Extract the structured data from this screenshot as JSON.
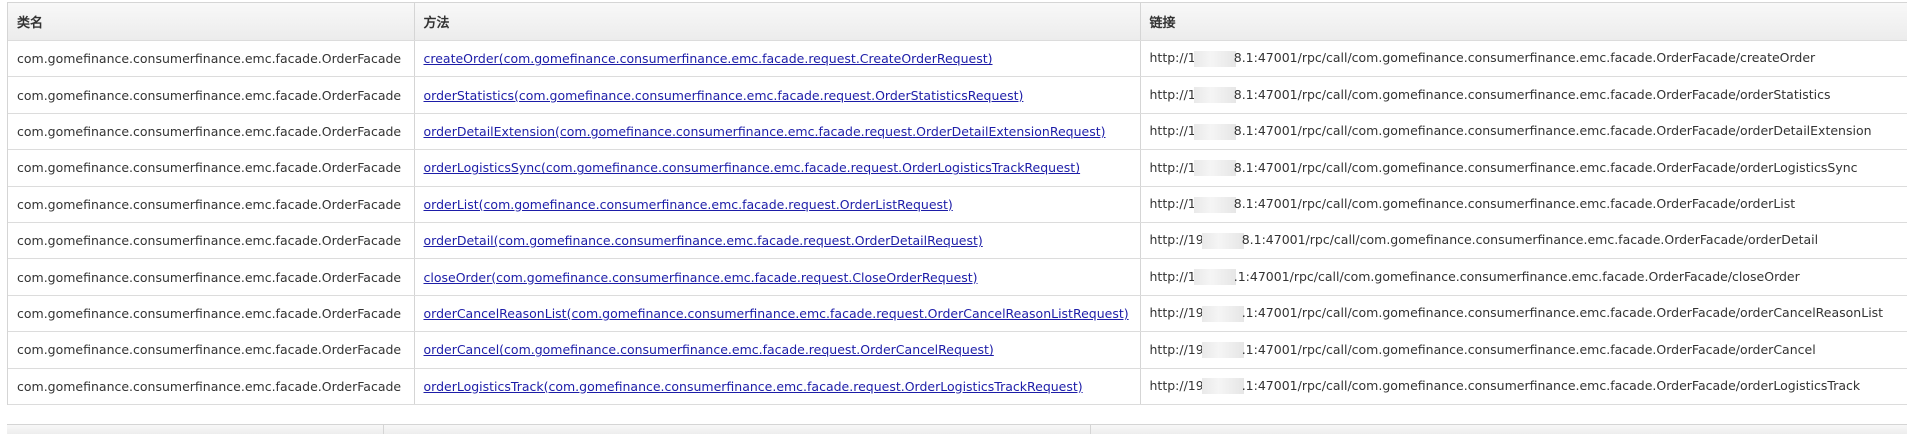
{
  "headers": {
    "class_name": "类名",
    "method": "方法",
    "link": "链接"
  },
  "rows": [
    {
      "class_name": "com.gomefinance.consumerfinance.emc.facade.OrderFacade",
      "method": "createOrder(com.gomefinance.consumerfinance.emc.facade.request.CreateOrderRequest)",
      "link_prefix": "http://1",
      "link_suffix": "8.1:47001/rpc/call/com.gomefinance.consumerfinance.emc.facade.OrderFacade/createOrder"
    },
    {
      "class_name": "com.gomefinance.consumerfinance.emc.facade.OrderFacade",
      "method": "orderStatistics(com.gomefinance.consumerfinance.emc.facade.request.OrderStatisticsRequest)",
      "link_prefix": "http://1",
      "link_suffix": "8.1:47001/rpc/call/com.gomefinance.consumerfinance.emc.facade.OrderFacade/orderStatistics"
    },
    {
      "class_name": "com.gomefinance.consumerfinance.emc.facade.OrderFacade",
      "method": "orderDetailExtension(com.gomefinance.consumerfinance.emc.facade.request.OrderDetailExtensionRequest)",
      "link_prefix": "http://1",
      "link_suffix": "8.1:47001/rpc/call/com.gomefinance.consumerfinance.emc.facade.OrderFacade/orderDetailExtension"
    },
    {
      "class_name": "com.gomefinance.consumerfinance.emc.facade.OrderFacade",
      "method": "orderLogisticsSync(com.gomefinance.consumerfinance.emc.facade.request.OrderLogisticsTrackRequest)",
      "link_prefix": "http://1",
      "link_suffix": "8.1:47001/rpc/call/com.gomefinance.consumerfinance.emc.facade.OrderFacade/orderLogisticsSync"
    },
    {
      "class_name": "com.gomefinance.consumerfinance.emc.facade.OrderFacade",
      "method": "orderList(com.gomefinance.consumerfinance.emc.facade.request.OrderListRequest)",
      "link_prefix": "http://1",
      "link_suffix": "8.1:47001/rpc/call/com.gomefinance.consumerfinance.emc.facade.OrderFacade/orderList"
    },
    {
      "class_name": "com.gomefinance.consumerfinance.emc.facade.OrderFacade",
      "method": "orderDetail(com.gomefinance.consumerfinance.emc.facade.request.OrderDetailRequest)",
      "link_prefix": "http://19",
      "link_suffix": "8.1:47001/rpc/call/com.gomefinance.consumerfinance.emc.facade.OrderFacade/orderDetail"
    },
    {
      "class_name": "com.gomefinance.consumerfinance.emc.facade.OrderFacade",
      "method": "closeOrder(com.gomefinance.consumerfinance.emc.facade.request.CloseOrderRequest)",
      "link_prefix": "http://1",
      "link_suffix": ".1:47001/rpc/call/com.gomefinance.consumerfinance.emc.facade.OrderFacade/closeOrder"
    },
    {
      "class_name": "com.gomefinance.consumerfinance.emc.facade.OrderFacade",
      "method": "orderCancelReasonList(com.gomefinance.consumerfinance.emc.facade.request.OrderCancelReasonListRequest)",
      "link_prefix": "http://19",
      "link_suffix": ".1:47001/rpc/call/com.gomefinance.consumerfinance.emc.facade.OrderFacade/orderCancelReasonList"
    },
    {
      "class_name": "com.gomefinance.consumerfinance.emc.facade.OrderFacade",
      "method": "orderCancel(com.gomefinance.consumerfinance.emc.facade.request.OrderCancelRequest)",
      "link_prefix": "http://19",
      "link_suffix": ".1:47001/rpc/call/com.gomefinance.consumerfinance.emc.facade.OrderFacade/orderCancel"
    },
    {
      "class_name": "com.gomefinance.consumerfinance.emc.facade.OrderFacade",
      "method": "orderLogisticsTrack(com.gomefinance.consumerfinance.emc.facade.request.OrderLogisticsTrackRequest)",
      "link_prefix": "http://19",
      "link_suffix": ".1:47001/rpc/call/com.gomefinance.consumerfinance.emc.facade.OrderFacade/orderLogisticsTrack"
    }
  ],
  "colors": {
    "link": "#1d1da8",
    "border": "#d5d5d5",
    "header_bg": "#f2f2f2",
    "text": "#333333"
  }
}
